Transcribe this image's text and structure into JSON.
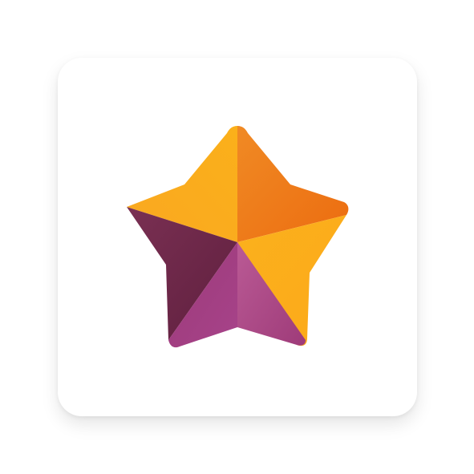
{
  "app_icon": {
    "name": "star-app-icon",
    "tile_color": "#ffffff",
    "logo": {
      "name": "faceted-star-icon",
      "colors": {
        "gold": "#fbad1c",
        "orange": "#ef7e22",
        "deep_orange": "#ec6f12",
        "plum": "#6d2748",
        "magenta": "#a3407f",
        "light_magenta": "#b55590"
      }
    }
  }
}
